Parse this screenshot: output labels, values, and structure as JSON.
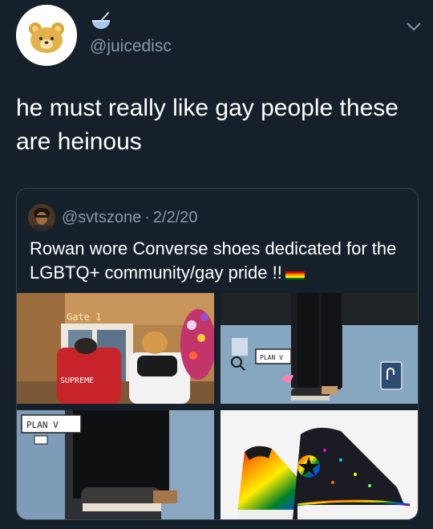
{
  "tweet": {
    "handle": "@juicedisc",
    "display_name_icon": "bowl-icon",
    "avatar": "bear-avatar",
    "menu_icon": "chevron-down-icon",
    "text": "he must really like gay people these are heinous"
  },
  "quote": {
    "handle": "@svtszone",
    "separator": "·",
    "date": "2/2/20",
    "text": "Rowan wore Converse shoes dedicated for the LGBTQ+ community/gay pride !!",
    "flag_icon": "rainbow-flag-icon",
    "media": [
      {
        "name": "airport-gate-photo",
        "sign_text": "Gate 1",
        "jacket_text": "SUPREME"
      },
      {
        "name": "stage-shoes-photo",
        "sticker_text": "PLAN V"
      },
      {
        "name": "shoes-closeup-photo",
        "sticker_text": "PLAN V"
      },
      {
        "name": "rainbow-converse-product-photo"
      }
    ]
  },
  "colors": {
    "background": "#15202b",
    "text_primary": "#ffffff",
    "text_secondary": "#8899a6",
    "border": "#38444d"
  }
}
